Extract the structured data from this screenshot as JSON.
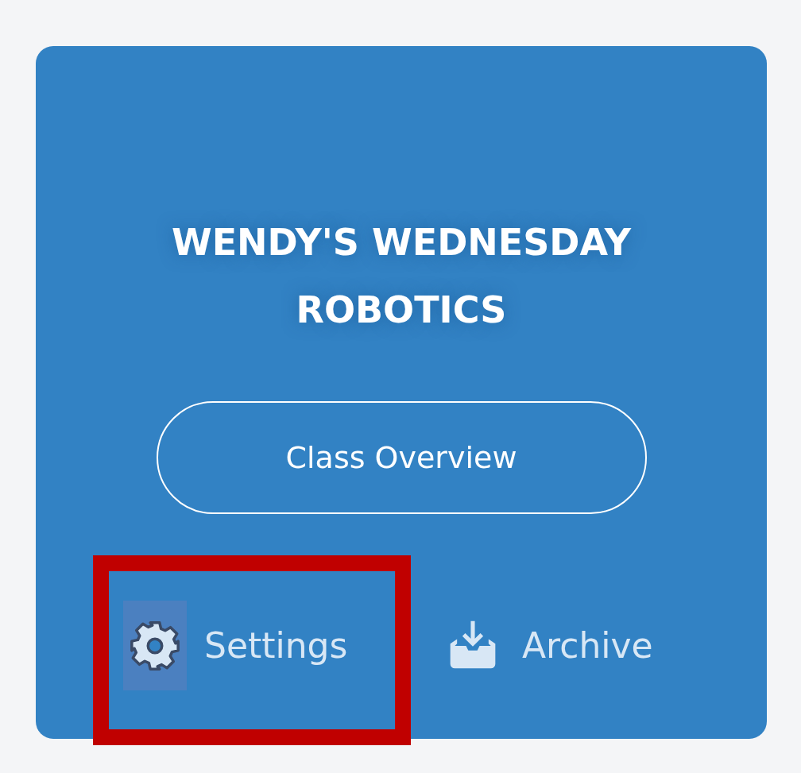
{
  "card": {
    "title": "WENDY'S WEDNESDAY ROBOTICS",
    "button": "Class Overview",
    "actions": [
      {
        "kind": "settings",
        "label": "Settings",
        "highlighted": true
      },
      {
        "kind": "archive",
        "label": "Archive",
        "highlighted": false
      }
    ]
  }
}
